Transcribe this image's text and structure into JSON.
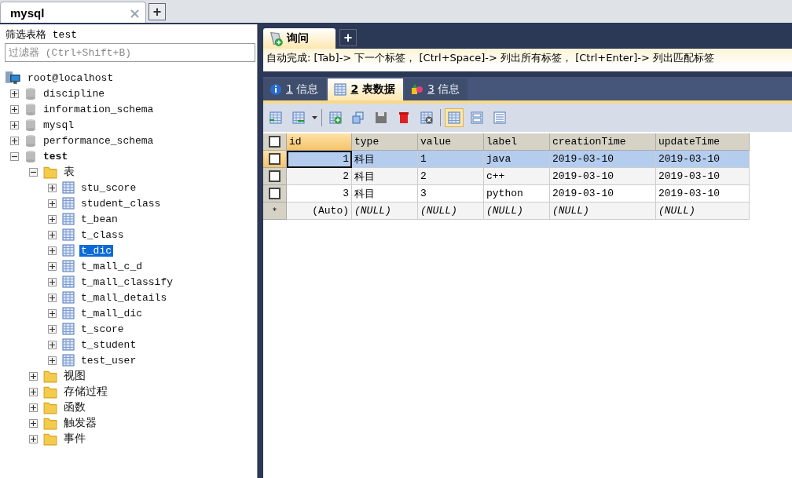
{
  "window_tabs": [
    {
      "label": "mysql",
      "selected": true,
      "close": "×"
    }
  ],
  "new_tab": "+",
  "sidebar": {
    "title": "筛选表格 test",
    "filter": {
      "placeholder": "过滤器 (Ctrl+Shift+B)"
    },
    "tree": [
      {
        "label": "root@localhost",
        "kind": "host",
        "children": [
          {
            "label": "discipline",
            "kind": "database",
            "expanded": false,
            "active": false
          },
          {
            "label": "information_schema",
            "kind": "database",
            "expanded": false,
            "active": false
          },
          {
            "label": "mysql",
            "kind": "database",
            "expanded": false,
            "active": false
          },
          {
            "label": "performance_schema",
            "kind": "database",
            "expanded": false,
            "active": false
          },
          {
            "label": "test",
            "kind": "database",
            "expanded": true,
            "active": true,
            "children": [
              {
                "label": "表",
                "kind": "folder",
                "expanded": true,
                "children": [
                  {
                    "label": "stu_score",
                    "kind": "table",
                    "expanded": false,
                    "selected": false
                  },
                  {
                    "label": "student_class",
                    "kind": "table",
                    "expanded": false,
                    "selected": false
                  },
                  {
                    "label": "t_bean",
                    "kind": "table",
                    "expanded": false,
                    "selected": false
                  },
                  {
                    "label": "t_class",
                    "kind": "table",
                    "expanded": false,
                    "selected": false
                  },
                  {
                    "label": "t_dic",
                    "kind": "table",
                    "expanded": false,
                    "selected": true
                  },
                  {
                    "label": "t_mall_c_d",
                    "kind": "table",
                    "expanded": false,
                    "selected": false
                  },
                  {
                    "label": "t_mall_classify",
                    "kind": "table",
                    "expanded": false,
                    "selected": false
                  },
                  {
                    "label": "t_mall_details",
                    "kind": "table",
                    "expanded": false,
                    "selected": false
                  },
                  {
                    "label": "t_mall_dic",
                    "kind": "table",
                    "expanded": false,
                    "selected": false
                  },
                  {
                    "label": "t_score",
                    "kind": "table",
                    "expanded": false,
                    "selected": false
                  },
                  {
                    "label": "t_student",
                    "kind": "table",
                    "expanded": false,
                    "selected": false
                  },
                  {
                    "label": "test_user",
                    "kind": "table",
                    "expanded": false,
                    "selected": false
                  }
                ]
              },
              {
                "label": "视图",
                "kind": "folder",
                "expanded": false
              },
              {
                "label": "存储过程",
                "kind": "folder",
                "expanded": false
              },
              {
                "label": "函数",
                "kind": "folder",
                "expanded": false
              },
              {
                "label": "触发器",
                "kind": "folder",
                "expanded": false
              },
              {
                "label": "事件",
                "kind": "folder",
                "expanded": false
              }
            ]
          }
        ]
      }
    ]
  },
  "query_tabs": [
    {
      "label": "询问",
      "selected": true
    }
  ],
  "query_new_tab": "+",
  "autocomplete_hint": "自动完成: [Tab]-> 下一个标签， [Ctrl+Space]-> 列出所有标签， [Ctrl+Enter]-> 列出匹配标签",
  "result_tabs": [
    {
      "number": "1",
      "label": "信息",
      "kind": "info",
      "selected": false
    },
    {
      "number": "2",
      "label": "表数据",
      "kind": "table",
      "selected": true
    },
    {
      "number": "3",
      "label": "信息",
      "kind": "profile",
      "selected": false
    }
  ],
  "view_modes": [
    {
      "kind": "grid",
      "selected": true
    },
    {
      "kind": "form",
      "selected": false
    },
    {
      "kind": "text",
      "selected": false
    }
  ],
  "table": {
    "select_all": {
      "checked": false
    },
    "columns": [
      {
        "label": "id",
        "active": true
      },
      {
        "label": "type",
        "active": false
      },
      {
        "label": "value",
        "active": false
      },
      {
        "label": "label",
        "active": false
      },
      {
        "label": "creationTime",
        "active": false
      },
      {
        "label": "updateTime",
        "active": false
      }
    ],
    "rows": [
      {
        "kind": "data",
        "selected": true,
        "checked": false,
        "cells": [
          "1",
          "科目",
          "1",
          "java",
          "2019-03-10",
          "2019-03-10"
        ]
      },
      {
        "kind": "data",
        "selected": false,
        "checked": false,
        "cells": [
          "2",
          "科目",
          "2",
          "c++",
          "2019-03-10",
          "2019-03-10"
        ]
      },
      {
        "kind": "data",
        "selected": false,
        "checked": false,
        "cells": [
          "3",
          "科目",
          "3",
          "python",
          "2019-03-10",
          "2019-03-10"
        ]
      },
      {
        "kind": "new",
        "marker": "*",
        "selected": false,
        "cells": [
          "(Auto)",
          "(NULL)",
          "(NULL)",
          "(NULL)",
          "(NULL)",
          "(NULL)"
        ]
      }
    ]
  }
}
